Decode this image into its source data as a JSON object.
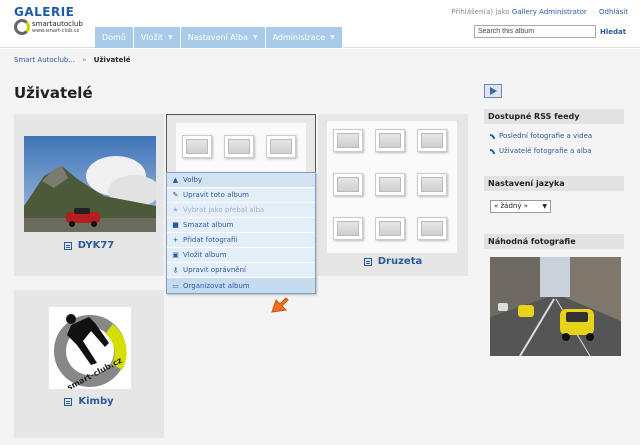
{
  "header": {
    "logo_title": "GALERIE",
    "logo_brand": "smartautoclub",
    "logo_url": "www.smart-club.cz",
    "user_prefix": "Přihlášen(a) jako",
    "user_name": "Gallery Administrator",
    "logout": "Odhlásit",
    "search_placeholder": "Search this album",
    "search_button": "Hledat"
  },
  "nav": {
    "items": [
      {
        "label": "Domů",
        "dropdown": false
      },
      {
        "label": "Vložit",
        "dropdown": true
      },
      {
        "label": "Nastavení Alba",
        "dropdown": true
      },
      {
        "label": "Administrace",
        "dropdown": true
      }
    ]
  },
  "breadcrumb": {
    "parent": "Smart Autoclub...",
    "separator": "»",
    "current": "Uživatelé"
  },
  "page_title": "Uživatelé",
  "albums": [
    {
      "name": "DYK77"
    },
    {
      "name": ""
    },
    {
      "name": "Druzeta"
    },
    {
      "name": "Kimby"
    }
  ],
  "context_menu": {
    "header": "Volby",
    "items": [
      {
        "label": "Upravit toto album",
        "icon": "pencil-icon",
        "disabled": false
      },
      {
        "label": "Vybrat jako přebal alba",
        "icon": "star-icon",
        "disabled": true
      },
      {
        "label": "Smazat album",
        "icon": "trash-icon",
        "disabled": false
      },
      {
        "label": "Přidat fotografii",
        "icon": "plus-icon",
        "disabled": false
      },
      {
        "label": "Vložit album",
        "icon": "album-icon",
        "disabled": false
      },
      {
        "label": "Upravit oprávnění",
        "icon": "key-icon",
        "disabled": false
      },
      {
        "label": "Organizovat album",
        "icon": "folder-icon",
        "disabled": false
      }
    ]
  },
  "sidebar": {
    "rss_title": "Dostupné RSS feedy",
    "rss_links": [
      "Poslední fotografie a videa",
      "Uživatelé fotografie a alba"
    ],
    "lang_title": "Nastavení jazyka",
    "lang_value": "« žádný »",
    "random_title": "Náhodná fotografie"
  },
  "kimby_logo_text": "smart-club.cz",
  "colors": {
    "nav": "#a9cbea",
    "link": "#2a5a9c",
    "menu_bg": "#e4eef8",
    "cursor": "#f07020"
  }
}
